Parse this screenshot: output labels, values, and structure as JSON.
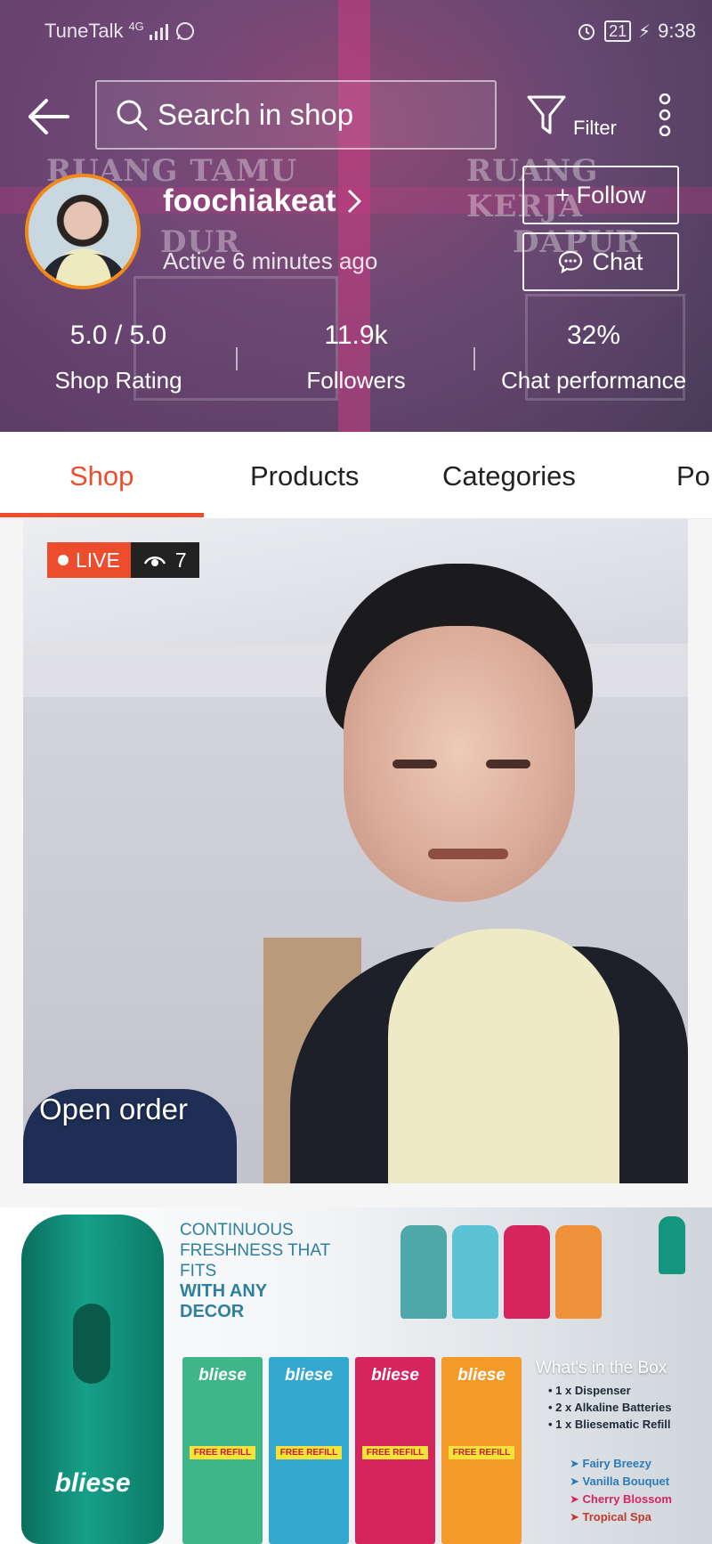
{
  "status_bar": {
    "carrier": "TuneTalk",
    "network": "4G",
    "battery": "21",
    "time": "9:38"
  },
  "header": {
    "search_placeholder": "Search in shop",
    "filter_label": "Filter",
    "shop_name": "foochiakeat",
    "active_status": "Active 6 minutes ago",
    "follow_label": "+ Follow",
    "chat_label": "Chat",
    "banner_words": [
      "RUANG TAMU",
      "RUANG KERJA",
      "DUR",
      "DAPUR"
    ],
    "stats": [
      {
        "value": "5.0 / 5.0",
        "label": "Shop Rating"
      },
      {
        "value": "11.9k",
        "label": "Followers"
      },
      {
        "value": "32%",
        "label": "Chat performance"
      }
    ]
  },
  "tabs": [
    {
      "label": "Shop",
      "active": true
    },
    {
      "label": "Products",
      "active": false
    },
    {
      "label": "Categories",
      "active": false
    },
    {
      "label": "Po",
      "active": false
    }
  ],
  "live": {
    "badge": "LIVE",
    "viewers": "7",
    "caption": "Open order"
  },
  "promo": {
    "tagline_lines": [
      "CONTINUOUS",
      "FRESHNESS THAT",
      "FITS"
    ],
    "tagline_strong": [
      "WITH ANY",
      "DECOR"
    ],
    "brand": "bliese",
    "box_brand": "bliese",
    "box_refill": "FREE REFILL",
    "whats_title": "What's in the Box",
    "whats_items": [
      "1 x Dispenser",
      "2 x Alkaline Batteries",
      "1 x Bliesematic Refill"
    ],
    "scents": [
      "Fairy Breezy",
      "Vanilla Bouquet",
      "Cherry Blossom",
      "Tropical Spa"
    ]
  },
  "colors": {
    "accent": "#ee4d2d",
    "avatar_ring": "#f28a1a",
    "box_colors": [
      "#3fb58a",
      "#35a8cf",
      "#d6245e",
      "#f39a2a"
    ],
    "can_colors": [
      "#4fa8a8",
      "#5cc3d6",
      "#d6245e",
      "#f0913a"
    ],
    "scent_colors": [
      "#2c7ab8",
      "#2c7ab8",
      "#d6245e",
      "#c0392b"
    ]
  }
}
